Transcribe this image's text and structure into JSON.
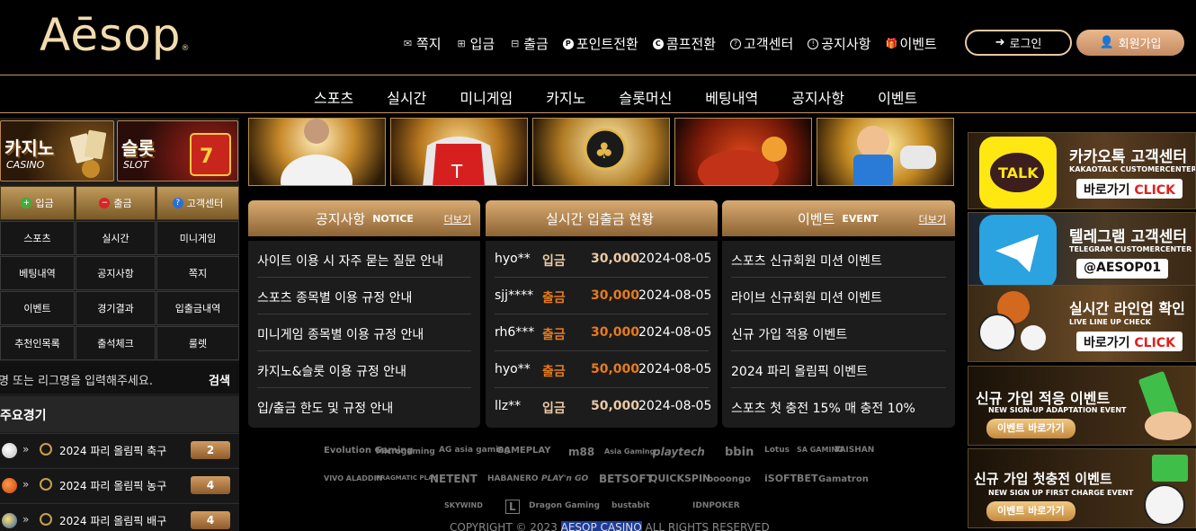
{
  "logo": {
    "text": "Aēsop",
    "reg": "®"
  },
  "topmenu": [
    {
      "icon": "✉",
      "label": "쪽지"
    },
    {
      "icon": "⊞",
      "label": "입금"
    },
    {
      "icon": "⊟",
      "label": "출금"
    },
    {
      "icon": "P",
      "label": "포인트전환"
    },
    {
      "icon": "C",
      "label": "콤프전환"
    },
    {
      "icon": "?",
      "label": "고객센터"
    },
    {
      "icon": "!",
      "label": "공지사항"
    },
    {
      "icon": "🎁",
      "label": "이벤트"
    }
  ],
  "auth": {
    "login": "로그인",
    "join": "회원가입"
  },
  "nav": [
    "스포츠",
    "실시간",
    "미니게임",
    "카지노",
    "슬롯머신",
    "베팅내역",
    "공지사항",
    "이벤트"
  ],
  "left": {
    "promo_casino": {
      "big": "카지노",
      "small": "CASINO"
    },
    "promo_slot": {
      "big": "슬롯",
      "small": "SLOT"
    },
    "gold_buttons": [
      "입금",
      "출금",
      "고객센터"
    ],
    "grid": [
      "스포츠",
      "실시간",
      "미니게임",
      "베팅내역",
      "공지사항",
      "쪽지",
      "이벤트",
      "경기결과",
      "입출금내역",
      "추천인목록",
      "출석체크",
      "룰렛"
    ],
    "search_placeholder": "팀명 또는 리그명을 입력해주세요.",
    "search_button": "검색",
    "main_games_title": "주요경기",
    "main_games": [
      {
        "label": "2024 파리 올림픽 축구",
        "count": "2",
        "ball_color": "#e8e8e8"
      },
      {
        "label": "2024 파리 올림픽 농구",
        "count": "4",
        "ball_color": "#e0661c"
      },
      {
        "label": "2024 파리 올림픽 배구",
        "count": "4",
        "ball_color": "#f0c21a"
      }
    ]
  },
  "panels": {
    "notice": {
      "title": "공지사항",
      "en": "NOTICE",
      "more": "더보기",
      "items": [
        "사이트 이용 시 자주 묻는 질문 안내",
        "스포츠 종목별 이용 규정 안내",
        "미니게임 종목별 이용 규정 안내",
        "카지노&슬롯 이용 규정 안내",
        "입/출금 한도 및 규정 안내"
      ]
    },
    "realtime": {
      "title": "실시간 입출금 현황",
      "rows": [
        {
          "user": "hyo**",
          "type": "입금",
          "amount": "30,000",
          "date": "2024-08-05"
        },
        {
          "user": "sjj****",
          "type": "출금",
          "amount": "30,000",
          "date": "2024-08-05"
        },
        {
          "user": "rh6***",
          "type": "출금",
          "amount": "30,000",
          "date": "2024-08-05"
        },
        {
          "user": "hyo**",
          "type": "출금",
          "amount": "50,000",
          "date": "2024-08-05"
        },
        {
          "user": "llz**",
          "type": "입금",
          "amount": "50,000",
          "date": "2024-08-05"
        }
      ]
    },
    "event": {
      "title": "이벤트",
      "en": "EVENT",
      "more": "더보기",
      "items": [
        "스포츠 신규회원 미션 이벤트",
        "라이브 신규회원 미션 이벤트",
        "신규 가입 적용 이벤트",
        "2024 파리 올림픽 이벤트",
        "스포츠 첫 충전 15% 매 충전 10%"
      ]
    }
  },
  "providers": [
    "Evolution Gaming",
    "Microgaming",
    "AG asia gaming",
    "GAMEPLAY",
    "m88",
    "Asia Gaming",
    "playtech",
    "bbin",
    "Lotus",
    "SA GAMING",
    "TAISHAN",
    "VIVO ALADDIN",
    "PRAGMATIC PLAY",
    "NETENT",
    "HABANERO",
    "PLAY'n GO",
    "BETSOFT",
    "QUICKSPIN",
    "booongo",
    "iSOFTBET",
    "Gamatron",
    "SKYWIND",
    "L",
    "Dragon Gaming",
    "bustabit",
    "IDNPOKER"
  ],
  "copyright": {
    "prefix": "COPYRIGHT © 2023 ",
    "brand": "AESOP CASINO",
    "suffix": " ALL RIGHTS RESERVED"
  },
  "right_banners": [
    {
      "t1": "카카오톡 고객센터",
      "t2": "KAKAOTALK CUSTOMERCENTER",
      "btn": "바로가기 ",
      "btn_red": "CLICK",
      "icon": "TALK"
    },
    {
      "t1": "텔레그램 고객센터",
      "t2": "TELEGRAM CUSTOMERCENTER",
      "btn": "@AESOP01",
      "btn_red": "",
      "icon": "telegram"
    },
    {
      "t1": "실시간 라인업 확인",
      "t2": "LIVE LINE UP CHECK",
      "btn": "바로가기 ",
      "btn_red": "CLICK",
      "icon": "balls"
    },
    {
      "t1": "신규 가입 적응 이벤트",
      "t2": "NEW SIGN-UP ADAPTATION EVENT",
      "btn": "이벤트 바로가기",
      "btn_red": "",
      "icon": "cash"
    },
    {
      "t1": "신규 가입 첫충전 이벤트",
      "t2": "NEW SIGN UP FIRST CHARGE EVENT",
      "btn": "이벤트 바로가기",
      "btn_red": "",
      "icon": "ball-cash"
    }
  ],
  "colors": {
    "accent": "#c8936a",
    "gold_text": "#f2dcae",
    "orange": "#e77b1c",
    "beige_amount": "#e9c9a4"
  }
}
